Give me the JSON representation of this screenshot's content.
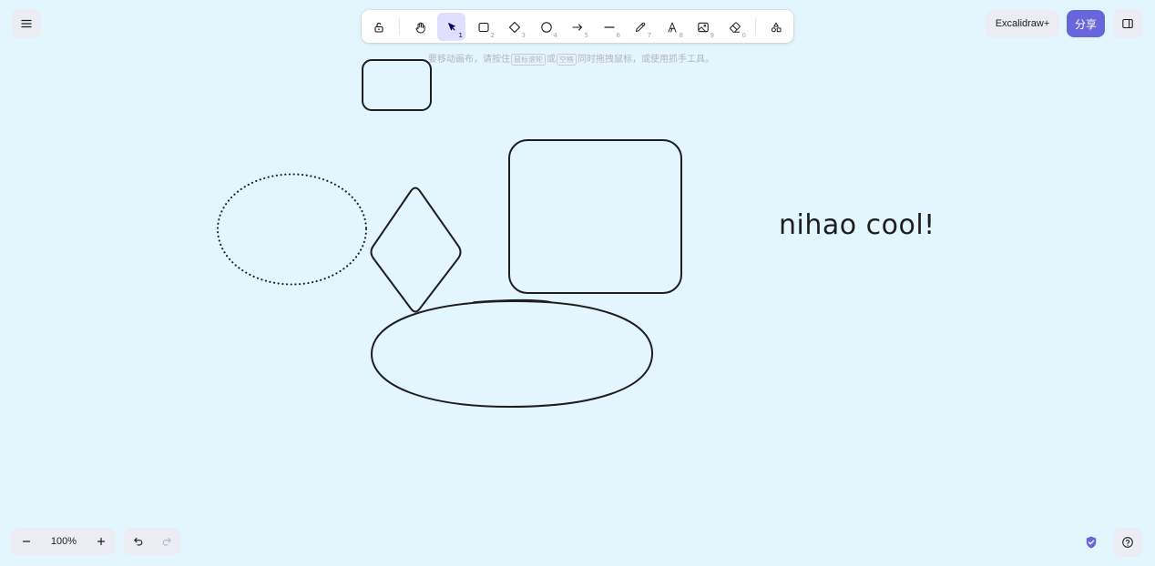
{
  "toolbar": {
    "tools": [
      {
        "name": "lock",
        "key": ""
      },
      {
        "name": "hand",
        "key": ""
      },
      {
        "name": "selection",
        "key": "1",
        "active": true
      },
      {
        "name": "rectangle",
        "key": "2"
      },
      {
        "name": "diamond",
        "key": "3"
      },
      {
        "name": "ellipse",
        "key": "4"
      },
      {
        "name": "arrow",
        "key": "5"
      },
      {
        "name": "line",
        "key": "6"
      },
      {
        "name": "draw",
        "key": "7"
      },
      {
        "name": "text",
        "key": "8"
      },
      {
        "name": "image",
        "key": "9"
      },
      {
        "name": "eraser",
        "key": "0"
      },
      {
        "name": "extra-tools",
        "key": ""
      }
    ]
  },
  "hint": {
    "prefix": "要移动画布，请按住",
    "key1": "鼠标滚轮",
    "middle": "或",
    "key2": "空格",
    "suffix": "同时拖拽鼠标，或使用抓手工具。"
  },
  "header": {
    "plus_label": "Excalidraw+",
    "share_label": "分享"
  },
  "footer": {
    "zoom_level": "100%"
  },
  "canvas": {
    "text": "nihao cool!",
    "stroke_color": "#1e1e1e",
    "background_color": "#e3f5fd"
  },
  "colors": {
    "accent": "#6965db",
    "active_tool_bg": "#e0dfff",
    "island_bg": "#ececf4"
  }
}
